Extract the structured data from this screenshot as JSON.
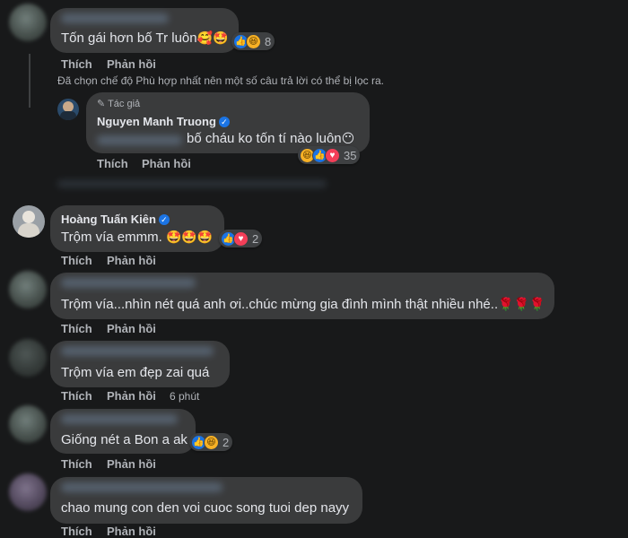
{
  "colors": {
    "background": "#18191a",
    "bubble": "#3a3b3c",
    "like": "#1b74e4",
    "love": "#f33e58",
    "haha": "#f7b125",
    "muted": "#b0b3b8"
  },
  "actions": {
    "like": "Thích",
    "reply": "Phản hồi"
  },
  "filter_notice": "Đã chọn chế độ Phù hợp nhất nên một số câu trả lời có thể bị lọc ra.",
  "comments": [
    {
      "text": "Tốn gái hơn bố Tr luôn",
      "emoji": "🥰🤩",
      "reaction_icons": [
        "like-icon",
        "haha-icon"
      ],
      "reaction_count": "8"
    },
    {
      "author_badge": "Tác giả",
      "name": "Nguyen Manh Truong",
      "verified": true,
      "text": "bố cháu ko tốn tí nào luôn",
      "emoji": "😶",
      "reaction_icons": [
        "haha-icon",
        "like-icon",
        "love-icon"
      ],
      "reaction_count": "35"
    },
    {
      "name": "Hoàng Tuấn Kiên",
      "verified": true,
      "text": "Trộm vía emmm. ",
      "emoji": "🤩🤩🤩",
      "reaction_icons": [
        "like-icon",
        "love-icon"
      ],
      "reaction_count": "2"
    },
    {
      "text": "Trộm vía...nhìn nét quá anh ơi..chúc mừng gia đình mình thật nhiều nhé..",
      "emoji": "🌹🌹🌹"
    },
    {
      "text": "Trộm vía em đẹp zai quá",
      "time": "6 phút"
    },
    {
      "text": "Giống nét a Bon a ak",
      "reaction_icons": [
        "like-icon",
        "haha-icon"
      ],
      "reaction_count": "2"
    },
    {
      "text": "chao mung con den voi cuoc song tuoi dep nayy"
    }
  ]
}
